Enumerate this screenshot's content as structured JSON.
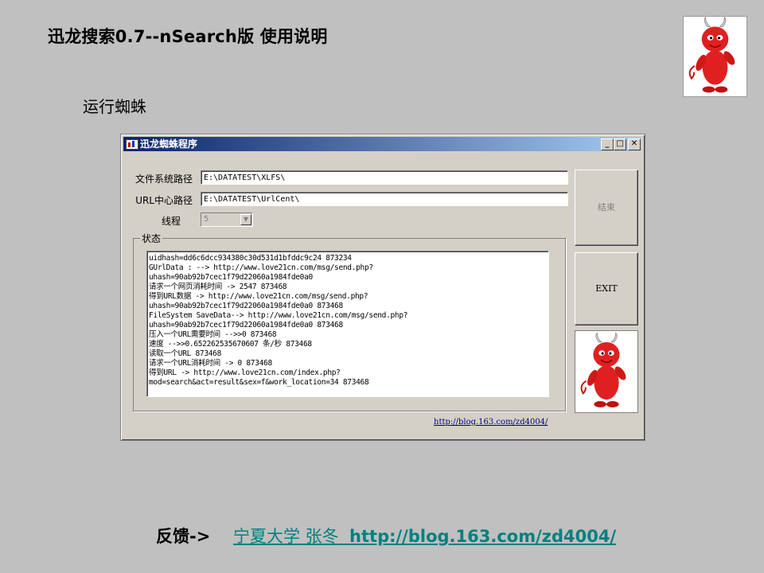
{
  "slide": {
    "title": "迅龙搜索0.7--nSearch版  使用说明",
    "subtitle": "运行蜘蛛"
  },
  "window": {
    "title": "迅龙蜘蛛程序",
    "minimize": "_",
    "maximize": "□",
    "close": "✕",
    "fields": {
      "fs_path_label": "文件系统路径",
      "fs_path_value": "E:\\DATATEST\\XLFS\\",
      "url_path_label": "URL中心路径",
      "url_path_value": "E:\\DATATEST\\UrlCent\\",
      "threads_label": "线程",
      "threads_value": "5"
    },
    "status_label": "状态",
    "log_lines": [
      "uidhash=dd6c6dcc934380c30d531d1bfddc9c24   873234",
      "GUrlData : --> http://www.love21cn.com/msg/send.php?",
      "uhash=90ab92b7cec1f79d22060a1984fde0a0",
      "请求一个网页消耗时间 -> 2547   873468",
      "得到URL数据 -> http://www.love21cn.com/msg/send.php?",
      "uhash=90ab92b7cec1f79d22060a1984fde0a0   873468",
      " FileSystem SaveData--> http://www.love21cn.com/msg/send.php?",
      "uhash=90ab92b7cec1f79d22060a1984fde0a0   873468",
      "压入一个URL需要时间 -->>0   873468",
      "速度 -->>0.652262535670607 条/秒   873468",
      "读取一个URL   873468",
      "请求一个URL消耗时间 -> 0   873468",
      "得到URL -> http://www.love21cn.com/index.php?",
      "mod=search&act=result&sex=f&work_location=34   873468"
    ],
    "end_button": "结束",
    "exit_button": "EXIT",
    "link": "http://blog.163.com/zd4004/"
  },
  "footer": {
    "label": "反馈->",
    "link_text": "宁夏大学 张冬",
    "link_url": "http://blog.163.com/zd4004/"
  },
  "icons": {
    "logo": "devil-mascot-icon",
    "app": "app-window-icon"
  },
  "colors": {
    "background": "#c0c0c0",
    "titlebar_start": "#0a246a",
    "titlebar_end": "#a6caf0",
    "footer_link": "#008080",
    "devil_red": "#e02020"
  }
}
